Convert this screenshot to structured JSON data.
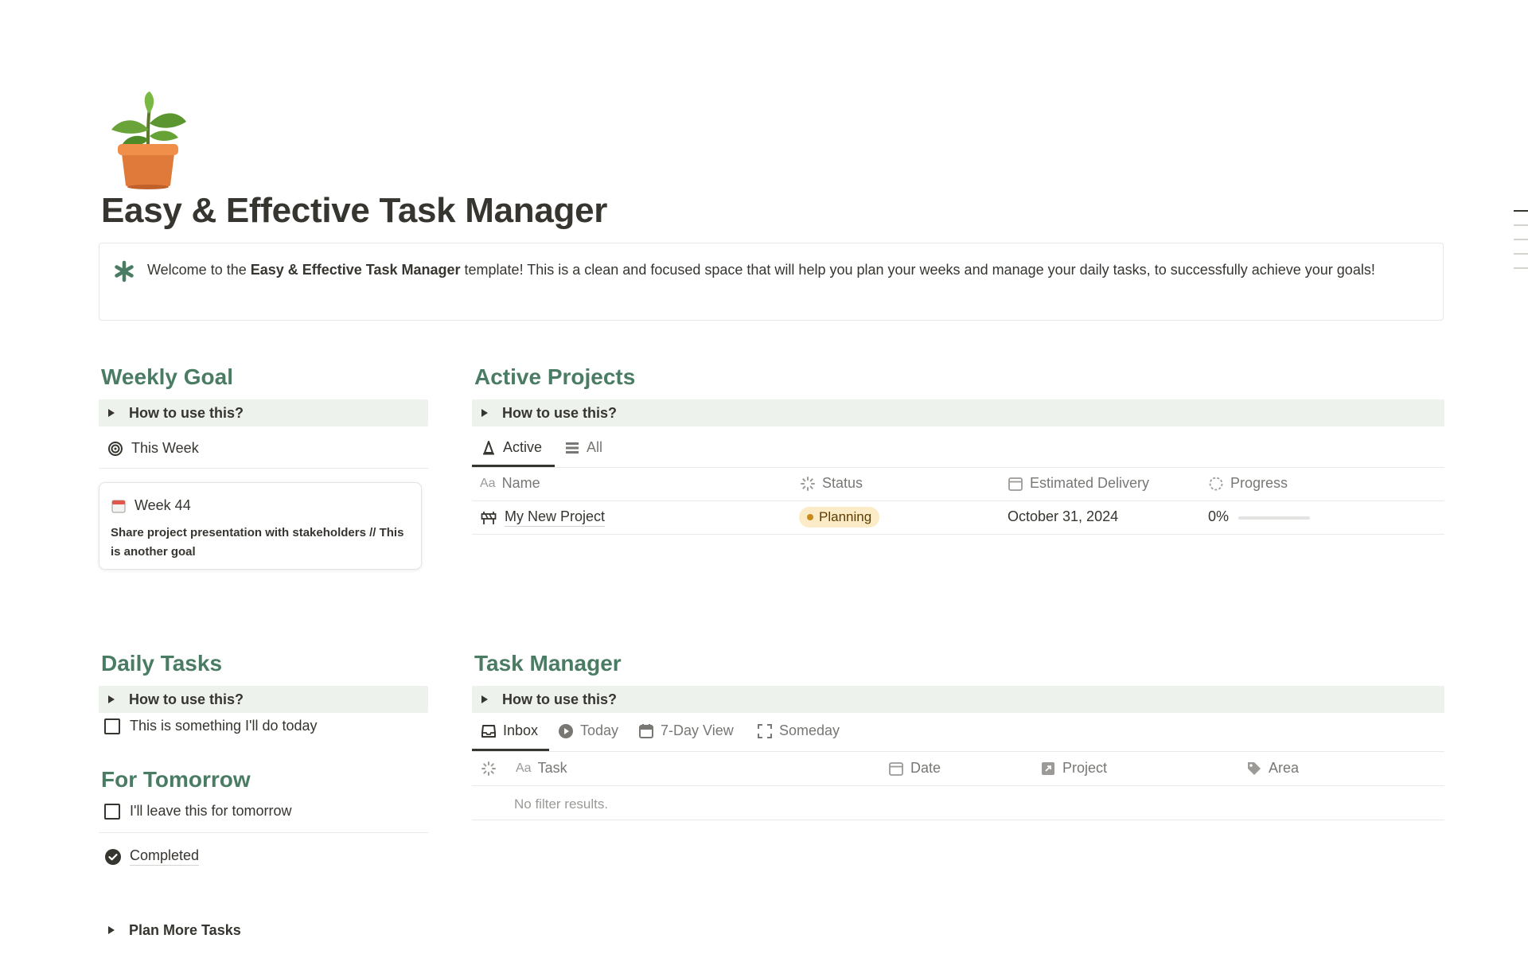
{
  "page": {
    "icon": "potted-plant-icon",
    "title": "Easy & Effective Task Manager"
  },
  "callout": {
    "icon": "asterisk-icon",
    "text_before": "Welcome to the ",
    "text_bold": "Easy & Effective Task Manager",
    "text_after": " template! This is a clean and focused space that will help you plan your weeks and manage your daily tasks, to successfully achieve your goals!"
  },
  "weekly_goal": {
    "heading": "Weekly Goal",
    "toggle_label": "How to use this?",
    "view_label": "This Week",
    "view_icon": "target-icon",
    "card": {
      "title": "Week 44",
      "icon": "calendar-icon",
      "body": "Share project presentation with stakeholders // This is another goal"
    }
  },
  "active_projects": {
    "heading": "Active Projects",
    "toggle_label": "How to use this?",
    "tabs": [
      {
        "label": "Active",
        "icon": "cone-icon",
        "active": true
      },
      {
        "label": "All",
        "icon": "list-icon",
        "active": false
      }
    ],
    "columns": [
      {
        "label": "Name",
        "icon": "text-aa-icon"
      },
      {
        "label": "Status",
        "icon": "status-loader-icon"
      },
      {
        "label": "Estimated Delivery",
        "icon": "calendar-icon"
      },
      {
        "label": "Progress",
        "icon": "progress-ring-icon"
      }
    ],
    "rows": [
      {
        "name": "My New Project",
        "icon": "barrier-icon",
        "status": "Planning",
        "delivery": "October 31, 2024",
        "progress_label": "0%",
        "progress": 0
      }
    ]
  },
  "daily_tasks": {
    "heading": "Daily Tasks",
    "toggle_label": "How to use this?",
    "items": [
      {
        "label": "This is something I'll do today",
        "checked": false
      }
    ]
  },
  "for_tomorrow": {
    "heading": "For Tomorrow",
    "items": [
      {
        "label": "I'll leave this for tomorrow",
        "checked": false
      }
    ],
    "completed_label": "Completed",
    "completed_icon": "check-circle-icon"
  },
  "plan_more": {
    "toggle_label": "Plan More Tasks"
  },
  "task_manager": {
    "heading": "Task Manager",
    "toggle_label": "How to use this?",
    "tabs": [
      {
        "label": "Inbox",
        "icon": "inbox-icon",
        "active": true
      },
      {
        "label": "Today",
        "icon": "play-circle-icon",
        "active": false
      },
      {
        "label": "7-Day View",
        "icon": "calendar-icon",
        "active": false
      },
      {
        "label": "Someday",
        "icon": "brackets-icon",
        "active": false
      }
    ],
    "columns": [
      {
        "label": "Task",
        "icon": "text-aa-icon"
      },
      {
        "label": "Date",
        "icon": "calendar-icon"
      },
      {
        "label": "Project",
        "icon": "relation-icon"
      },
      {
        "label": "Area",
        "icon": "tag-icon"
      }
    ],
    "empty_text": "No filter results."
  },
  "colors": {
    "heading_green": "#4a7c64",
    "toggle_bg": "#eef2ec",
    "badge_bg": "#fbecc7"
  }
}
